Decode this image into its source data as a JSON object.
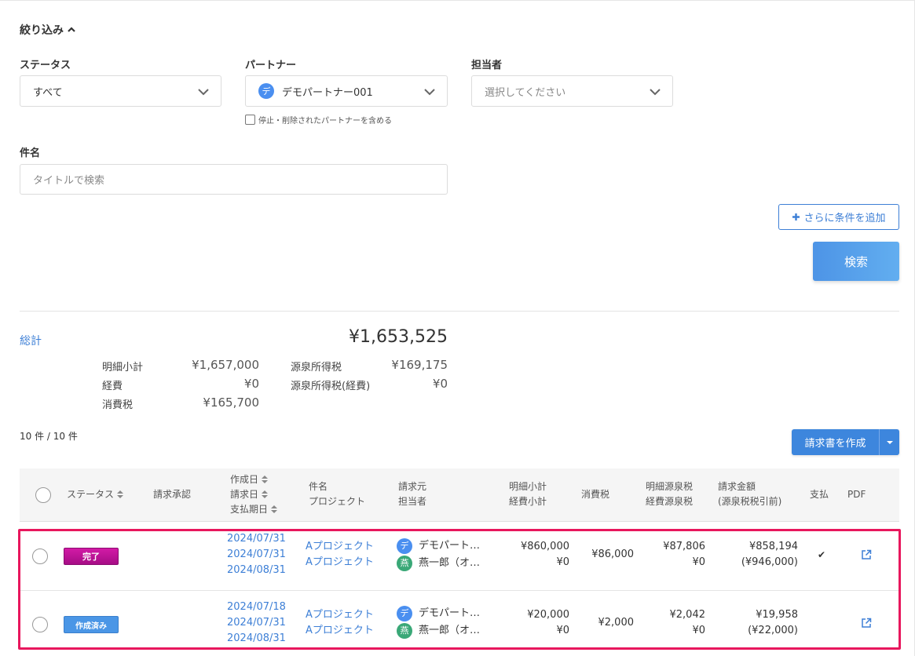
{
  "filter": {
    "title": "絞り込み",
    "status_label": "ステータス",
    "status_value": "すべて",
    "partner_label": "パートナー",
    "partner_avatar": "デ",
    "partner_value": "デモパートナー001",
    "partner_include_label": "停止・削除されたパートナーを含める",
    "assignee_label": "担当者",
    "assignee_placeholder": "選択してください",
    "subject_label": "件名",
    "subject_placeholder": "タイトルで検索",
    "add_condition_label": "さらに条件を追加",
    "search_label": "検索"
  },
  "summary": {
    "total_label": "総計",
    "total_value": "¥1,653,525",
    "subtotal_label": "明細小計",
    "subtotal_value": "¥1,657,000",
    "expense_label": "経費",
    "expense_value": "¥0",
    "tax_label": "消費税",
    "tax_value": "¥165,700",
    "withholding_label": "源泉所得税",
    "withholding_value": "¥169,175",
    "withholding_expense_label": "源泉所得税(経費)",
    "withholding_expense_value": "¥0"
  },
  "list": {
    "count": "10 件 / 10 件",
    "create_label": "請求書を作成"
  },
  "table": {
    "headers": {
      "status": "ステータス",
      "approval": "請求承認",
      "created": "作成日",
      "billed": "請求日",
      "due": "支払期日",
      "subject": "件名",
      "project": "プロジェクト",
      "client": "請求元",
      "owner": "担当者",
      "item_subtotal": "明細小計",
      "expense_subtotal": "経費小計",
      "tax": "消費税",
      "item_withholding": "明細源泉税",
      "expense_withholding": "経費源泉税",
      "amount": "請求金額",
      "amount_note": "(源泉税税引前)",
      "paid": "支払",
      "pdf": "PDF"
    },
    "rows": [
      {
        "status": "完了",
        "created": "2024/07/31",
        "billed": "2024/07/31",
        "due": "2024/08/31",
        "subject": "Aプロジェクト",
        "project": "Aプロジェクト",
        "client_avatar": "デ",
        "client": "デモパート…",
        "owner_avatar": "燕",
        "owner": "燕一郎（オ…",
        "item_subtotal": "¥860,000",
        "expense_subtotal": "¥0",
        "tax": "¥86,000",
        "item_withholding": "¥87,806",
        "expense_withholding": "¥0",
        "amount": "¥858,194",
        "amount_pretax": "(¥946,000)",
        "paid": "✔"
      },
      {
        "status": "作成済み",
        "created": "2024/07/18",
        "billed": "2024/07/31",
        "due": "2024/08/31",
        "subject": "Aプロジェクト",
        "project": "Aプロジェクト",
        "client_avatar": "デ",
        "client": "デモパート…",
        "owner_avatar": "燕",
        "owner": "燕一郎（オ…",
        "item_subtotal": "¥20,000",
        "expense_subtotal": "¥0",
        "tax": "¥2,000",
        "item_withholding": "¥2,042",
        "expense_withholding": "¥0",
        "amount": "¥19,958",
        "amount_pretax": "(¥22,000)",
        "paid": ""
      }
    ]
  },
  "colors": {
    "accent": "#3d7fd6",
    "done_badge": "#c0149a",
    "created_badge": "#4a96e6",
    "highlight": "#e8175d"
  }
}
